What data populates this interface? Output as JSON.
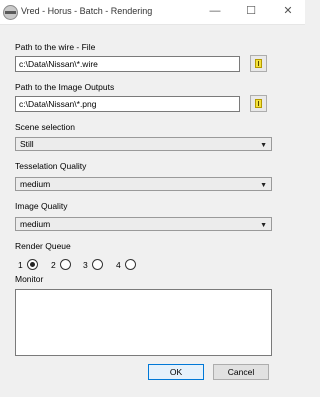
{
  "window": {
    "title": "Vred - Horus - Batch - Rendering",
    "minimize_glyph": "—",
    "maximize_glyph": "☐",
    "close_glyph": "✕"
  },
  "wire_path": {
    "label": "Path to the wire - File",
    "value": "c:\\Data\\Nissan\\*.wire"
  },
  "image_outputs": {
    "label": "Path to the Image Outputs",
    "value": "c:\\Data\\Nissan\\*.png"
  },
  "scene_selection": {
    "label": "Scene selection",
    "value": "Still"
  },
  "tesselation_quality": {
    "label": "Tesselation Quality",
    "value": "medium"
  },
  "image_quality": {
    "label": "Image Quality",
    "value": "medium"
  },
  "render_queue": {
    "label": "Render Queue",
    "options": [
      {
        "label": "1",
        "selected": true
      },
      {
        "label": "2",
        "selected": false
      },
      {
        "label": "3",
        "selected": false
      },
      {
        "label": "4",
        "selected": false
      }
    ]
  },
  "monitor": {
    "label": "Monitor",
    "value": ""
  },
  "buttons": {
    "ok": "OK",
    "cancel": "Cancel"
  },
  "icons": {
    "app": "nissan-logo-icon",
    "browse": "folder-icon",
    "dropdown": "chevron-down-icon"
  },
  "colors": {
    "window_bg": "#f0f0f0",
    "titlebar_bg": "#ffffff",
    "folder_yellow": "#f4e23c",
    "default_button_border": "#0078d7"
  }
}
